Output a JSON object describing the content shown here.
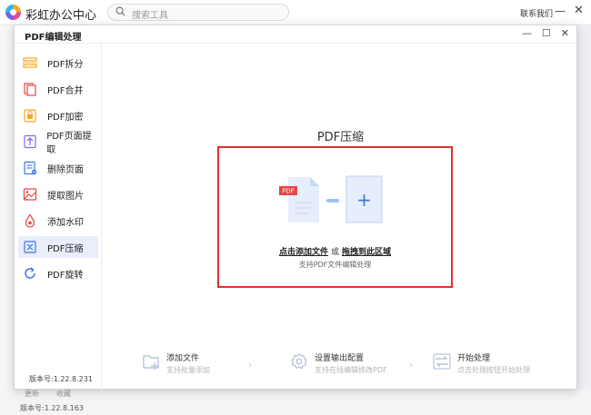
{
  "app": {
    "title": "彩虹办公中心",
    "search_placeholder": "搜索工具",
    "contact_label": "联系我们",
    "minimize": "—",
    "close": "✕",
    "bottom_tabs": [
      "更新",
      "收藏"
    ],
    "bottom_version": "版本号:1.22.8.163"
  },
  "dialog": {
    "title": "PDF编辑处理",
    "win_buttons": [
      "—",
      "☐",
      "✕"
    ],
    "sidebar": [
      {
        "label": "PDF拆分",
        "icon": "pdf-split-icon",
        "color": "#f5a623"
      },
      {
        "label": "PDF合并",
        "icon": "pdf-merge-icon",
        "color": "#e84545"
      },
      {
        "label": "PDF加密",
        "icon": "pdf-encrypt-icon",
        "color": "#f5a623"
      },
      {
        "label": "PDF页面提取",
        "icon": "pdf-extract-page-icon",
        "color": "#8a6ae8"
      },
      {
        "label": "删除页面",
        "icon": "delete-page-icon",
        "color": "#3a76e8"
      },
      {
        "label": "提取图片",
        "icon": "extract-image-icon",
        "color": "#e84545"
      },
      {
        "label": "添加水印",
        "icon": "add-watermark-icon",
        "color": "#e84545"
      },
      {
        "label": "PDF压缩",
        "icon": "pdf-compress-icon",
        "color": "#3a76e8",
        "active": true
      },
      {
        "label": "PDF旋转",
        "icon": "pdf-rotate-icon",
        "color": "#3a76e8"
      }
    ],
    "version": "版本号:1.22.8.231",
    "main": {
      "title": "PDF压缩",
      "pdf_tag": "PDF",
      "plus": "+",
      "drop_click": "点击添加文件",
      "drop_or": "或",
      "drop_drag": "拖拽到此区域",
      "drop_sub": "支持PDF文件编辑处理"
    },
    "steps": [
      {
        "title": "添加文件",
        "sub": "支持批量添加",
        "icon": "add-file-icon"
      },
      {
        "title": "设置输出配置",
        "sub": "支持在线编辑修改PDF",
        "icon": "settings-gear-icon"
      },
      {
        "title": "开始处理",
        "sub": "点击处理按钮开始处理",
        "icon": "start-process-icon"
      }
    ],
    "arrow": "›",
    "accent": "#3a76e8",
    "drop_border": "#e03030"
  }
}
